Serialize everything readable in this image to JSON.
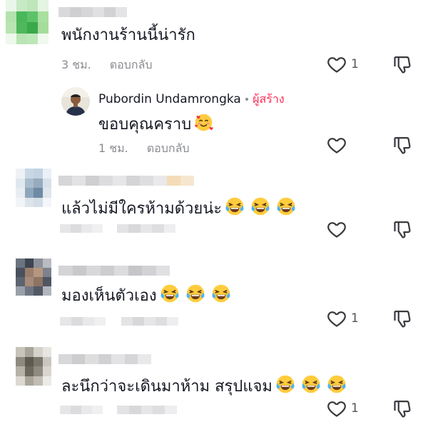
{
  "comments": [
    {
      "text": "พนักงานร้านนี้น่ารัก",
      "time": "3 ชม.",
      "reply": "ตอบกลับ",
      "likes": "1"
    },
    {
      "author": "Pubordin Undamrongka",
      "separator": "•",
      "creator_tag": "ผู้สร้าง",
      "text": "ขอบคุณคราบ",
      "emoji": "smiling-face-with-hearts",
      "time": "1 ชม.",
      "reply": "ตอบกลับ",
      "likes": ""
    },
    {
      "text": "แล้วไม่มีใครห้ามด้วยน่ะ",
      "emoji": "face-with-tears-of-joy",
      "emoji_count": 3,
      "likes": ""
    },
    {
      "text": "มองเห็นตัวเอง",
      "emoji": "face-with-tears-of-joy",
      "emoji_count": 3,
      "likes": "1"
    },
    {
      "text": "ละนึกว่าจะเดินมาห้าม สรุปแจม",
      "emoji": "face-with-tears-of-joy",
      "emoji_count": 3,
      "likes": "1"
    }
  ],
  "icons": {
    "like": "heart-outline-icon",
    "dislike": "thumbs-down-outline-icon"
  },
  "colors": {
    "creator_tag": "#fe2c55",
    "meta": "#8a8b91"
  }
}
